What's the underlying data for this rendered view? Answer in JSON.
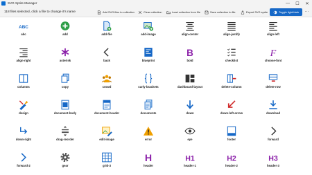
{
  "window": {
    "title": "SVG Sprite Manager",
    "minimize_glyph": "—",
    "maximize_glyph": "☐",
    "close_glyph": "✕"
  },
  "toolbar": {
    "status": "118 files selected, click a file to change it's name",
    "add_svg": "Add SVG files to collection",
    "clear": "Clear collection",
    "load": "Load collection from file",
    "save": "Save collection to file",
    "export": "Export SVG sprite",
    "toggle": "Toggle light/dark",
    "more": "···"
  },
  "colors": {
    "accent": "#1668c7",
    "purple": "#8b1fa9",
    "green": "#2e9e47",
    "red": "#d12b2b",
    "orange": "#f0a000"
  },
  "icons": [
    {
      "label": "abc",
      "icon": "abc-icon"
    },
    {
      "label": "add",
      "icon": "add-icon"
    },
    {
      "label": "add-file",
      "icon": "add-file-icon"
    },
    {
      "label": "add-image",
      "icon": "add-image-icon"
    },
    {
      "label": "align-center",
      "icon": "align-center-icon"
    },
    {
      "label": "align-justify",
      "icon": "align-justify-icon"
    },
    {
      "label": "align-left",
      "icon": "align-left-icon"
    },
    {
      "label": "align-right",
      "icon": "align-right-icon"
    },
    {
      "label": "asterisk",
      "icon": "asterisk-icon"
    },
    {
      "label": "back",
      "icon": "back-icon"
    },
    {
      "label": "blueprint",
      "icon": "blueprint-icon"
    },
    {
      "label": "bold",
      "icon": "bold-icon"
    },
    {
      "label": "checklist",
      "icon": "checklist-icon"
    },
    {
      "label": "choose-font",
      "icon": "choose-font-icon"
    },
    {
      "label": "columns",
      "icon": "columns-icon"
    },
    {
      "label": "copy",
      "icon": "copy-icon"
    },
    {
      "label": "crowd",
      "icon": "crowd-icon"
    },
    {
      "label": "curly-brackets",
      "icon": "curly-brackets-icon"
    },
    {
      "label": "dashboard-layout",
      "icon": "dashboard-layout-icon"
    },
    {
      "label": "delete-column",
      "icon": "delete-column-icon"
    },
    {
      "label": "delete-row",
      "icon": "delete-row-icon"
    },
    {
      "label": "design",
      "icon": "design-icon"
    },
    {
      "label": "document-body",
      "icon": "document-body-icon"
    },
    {
      "label": "document-header",
      "icon": "document-header-icon"
    },
    {
      "label": "documents",
      "icon": "documents-icon"
    },
    {
      "label": "down",
      "icon": "down-icon"
    },
    {
      "label": "down-left-arrow",
      "icon": "down-left-arrow-icon"
    },
    {
      "label": "download",
      "icon": "download-icon"
    },
    {
      "label": "down-right",
      "icon": "down-right-icon"
    },
    {
      "label": "drag-reorder",
      "icon": "drag-reorder-icon"
    },
    {
      "label": "edit-image",
      "icon": "edit-image-icon"
    },
    {
      "label": "error",
      "icon": "error-icon"
    },
    {
      "label": "eye",
      "icon": "eye-icon"
    },
    {
      "label": "footer",
      "icon": "footer-icon"
    },
    {
      "label": "forward",
      "icon": "forward-icon"
    },
    {
      "label": "forward-2",
      "icon": "forward-2-icon"
    },
    {
      "label": "gear",
      "icon": "gear-icon"
    },
    {
      "label": "grid-3",
      "icon": "grid-3-icon"
    },
    {
      "label": "header",
      "icon": "header-icon"
    },
    {
      "label": "header-1",
      "icon": "header-1-icon"
    },
    {
      "label": "header-2",
      "icon": "header-2-icon"
    },
    {
      "label": "header-3",
      "icon": "header-3-icon"
    }
  ]
}
